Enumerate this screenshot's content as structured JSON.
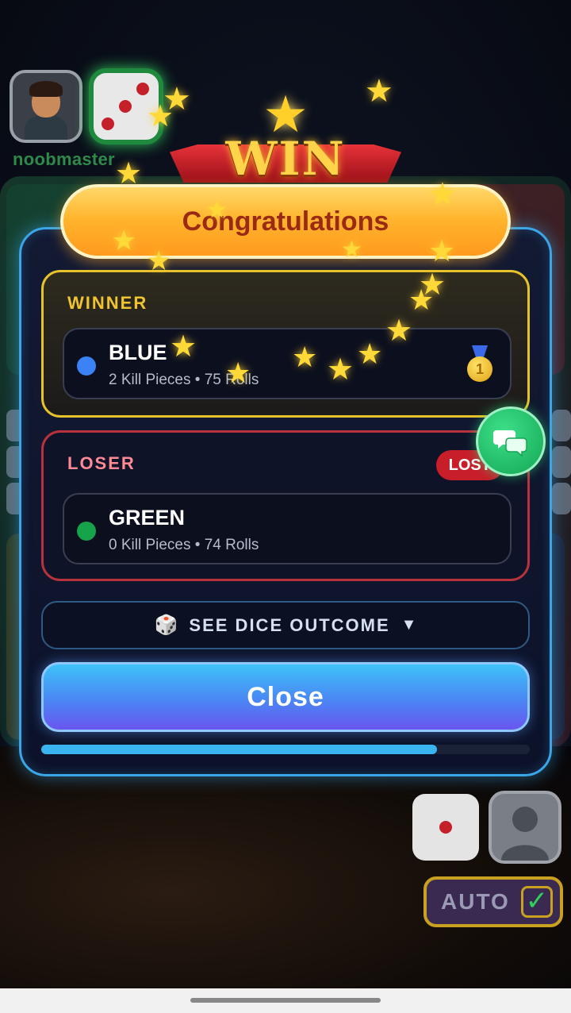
{
  "top_player": {
    "name": "noobmaster",
    "dice_value": 3
  },
  "bottom_player": {
    "dice_value": 1,
    "auto": {
      "label": "AUTO",
      "checked": true
    }
  },
  "dialog": {
    "win_text": "WIN",
    "title": "Congratulations",
    "winner": {
      "heading": "WINNER",
      "color_name": "BLUE",
      "color": "#3b82f6",
      "stats": "2 Kill Pieces • 75 Rolls"
    },
    "loser": {
      "heading": "LOSER",
      "badge": "LOST",
      "color_name": "GREEN",
      "color": "#16a34a",
      "stats": "0 Kill Pieces • 74 Rolls"
    },
    "dice_outcome_label": "SEE DICE OUTCOME",
    "close_label": "Close",
    "auto_close_progress": 0.81
  },
  "icons": {
    "win": "crown-icon",
    "medal": "gold-medal-icon",
    "dice": "dice-icon",
    "caret": "triangle-down-icon",
    "chat": "chat-bubbles-icon",
    "check": "check-icon"
  },
  "colors": {
    "dialog_border": "#3aa6e8",
    "winner_border": "#e8c22a",
    "loser_border": "#b8323e",
    "accent_gold": "#ffd938"
  }
}
